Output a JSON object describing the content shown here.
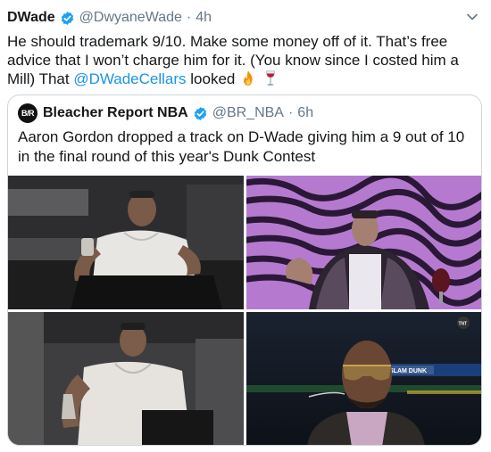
{
  "tweet": {
    "author_name": "DWade",
    "author_handle": "@DwyaneWade",
    "separator": "·",
    "time": "4h",
    "text_before": "He should trademark 9/10. Make some money off of it. That’s free advice that I won’t charge him for it. (You know since I costed him a Mill)  That ",
    "mention": "@DWadeCellars",
    "text_after": " looked "
  },
  "quoted": {
    "avatar_text": "B/R",
    "author_name": "Bleacher Report NBA",
    "author_handle": "@BR_NBA",
    "separator": "·",
    "time": "6h",
    "text": "Aaron Gordon dropped a track on D-Wade giving him a 9 out of 10 in the final round of this year's Dunk Contest"
  },
  "media": {
    "broadcast_logo": "TNT",
    "banner_text": "SLAM DUNK"
  },
  "icons": {
    "verified": "verified-badge-icon",
    "chevron": "chevron-down-icon",
    "fire": "fire-emoji-icon",
    "wine": "wine-glass-emoji-icon"
  },
  "colors": {
    "link": "#1b95e0",
    "verified": "#1da1f2",
    "muted": "#657786",
    "border": "#ccd6dd"
  }
}
